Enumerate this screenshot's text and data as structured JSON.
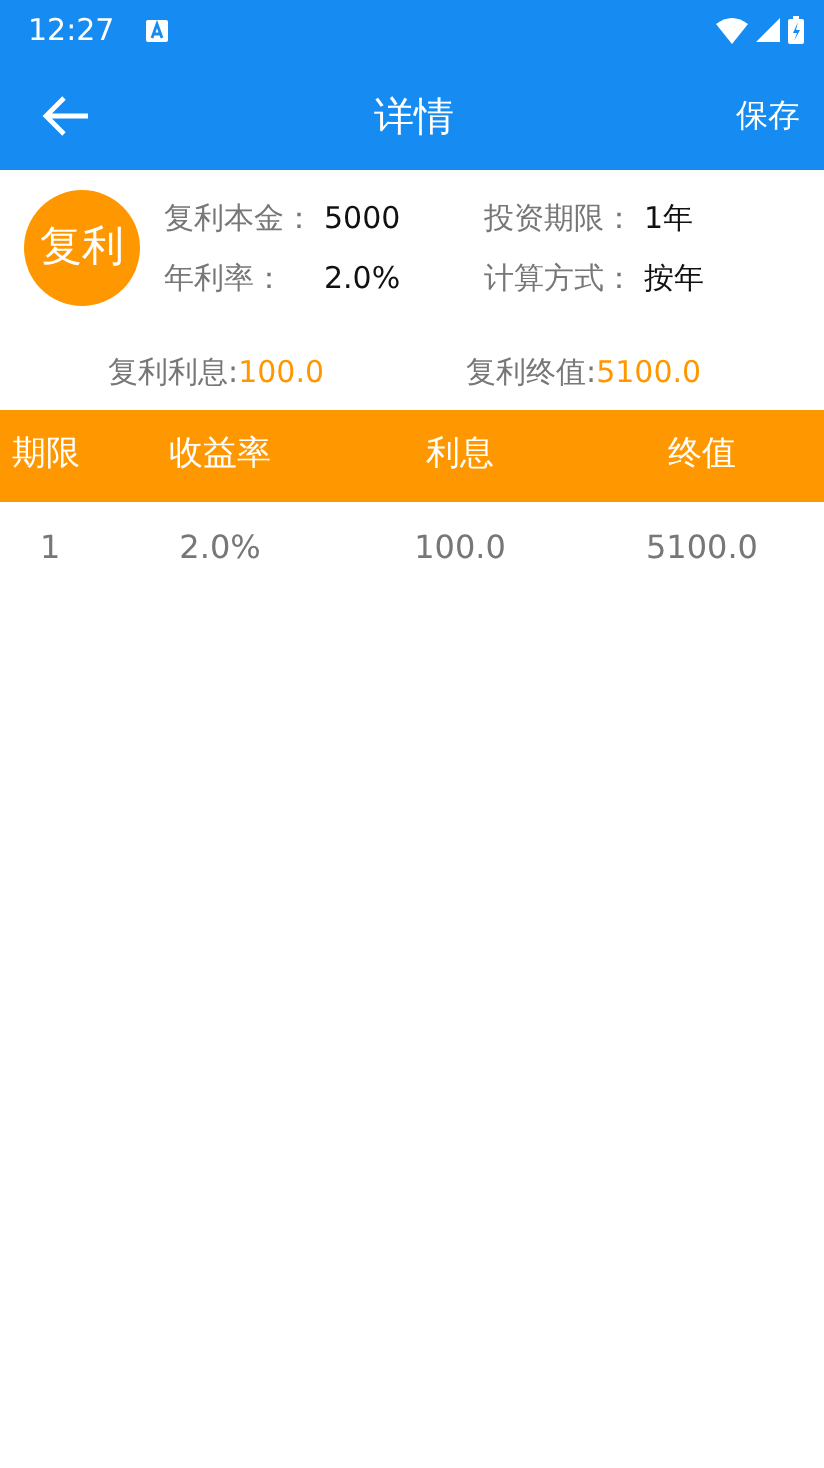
{
  "status_bar": {
    "time": "12:27"
  },
  "app_bar": {
    "title": "详情",
    "action": "保存"
  },
  "summary": {
    "badge": "复利",
    "fields": [
      {
        "label": "复利本金：",
        "value": "5000"
      },
      {
        "label": "投资期限：",
        "value": "1年"
      },
      {
        "label": "年利率：",
        "value": "2.0%"
      },
      {
        "label": "计算方式：",
        "value": "按年"
      }
    ],
    "totals": [
      {
        "label": "复利利息:",
        "value": "100.0"
      },
      {
        "label": "复利终值:",
        "value": "5100.0"
      }
    ]
  },
  "table": {
    "columns": [
      "期限",
      "收益率",
      "利息",
      "终值"
    ],
    "rows": [
      [
        "1",
        "2.0%",
        "100.0",
        "5100.0"
      ]
    ]
  }
}
